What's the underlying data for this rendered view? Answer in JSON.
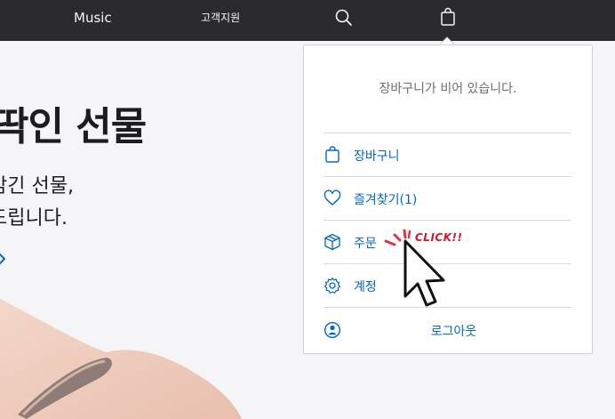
{
  "nav": {
    "music": "Music",
    "support": "고객지원",
    "search_icon": "search-icon",
    "bag_icon": "shopping-bag-icon"
  },
  "hero": {
    "title": "딱인 선물",
    "body_line1": "감긴 선물,",
    "body_line2": "드립니다.",
    "link_icon": "chevron-right-icon"
  },
  "bag_menu": {
    "empty_message": "장바구니가 비어 있습니다.",
    "items": [
      {
        "label": "장바구니",
        "icon": "bag-icon"
      },
      {
        "label": "즐겨찾기(1)",
        "icon": "heart-icon"
      },
      {
        "label": "주문",
        "icon": "box-icon"
      },
      {
        "label": "계정",
        "icon": "gear-icon"
      }
    ],
    "signout": {
      "label": "로그아웃",
      "icon": "person-circle-icon"
    }
  },
  "annotation": {
    "click_text": "CLICK!!"
  },
  "colors": {
    "nav_bg": "#2b2b2d",
    "link_blue": "#0066cc",
    "page_bg": "#f5f5f7",
    "click_red": "#d0182a"
  }
}
